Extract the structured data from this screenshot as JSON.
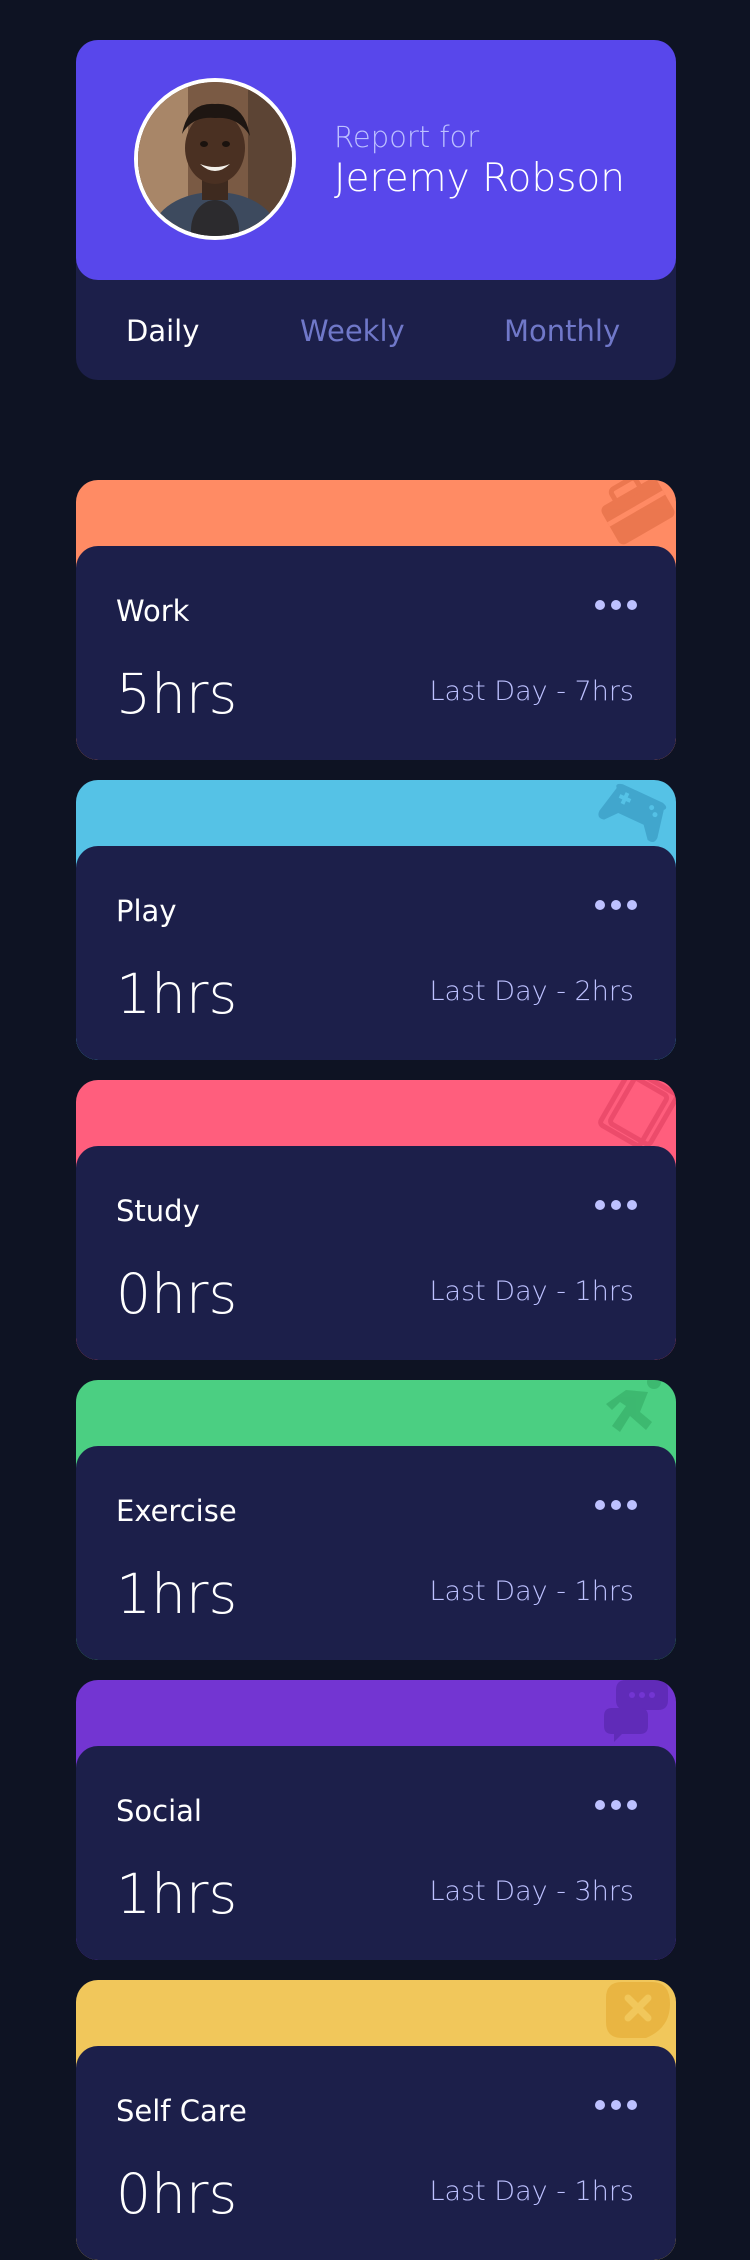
{
  "profile": {
    "report_for": "Report for",
    "name": "Jeremy Robson"
  },
  "tabs": [
    {
      "label": "Daily",
      "active": true
    },
    {
      "label": "Weekly",
      "active": false
    },
    {
      "label": "Monthly",
      "active": false
    }
  ],
  "activities": [
    {
      "title": "Work",
      "current": "5hrs",
      "previous": "Last Day - 7hrs",
      "color": "#ff8b64",
      "icon": "briefcase-icon"
    },
    {
      "title": "Play",
      "current": "1hrs",
      "previous": "Last Day - 2hrs",
      "color": "#55c2e6",
      "icon": "gamepad-icon"
    },
    {
      "title": "Study",
      "current": "0hrs",
      "previous": "Last Day - 1hrs",
      "color": "#ff5e7d",
      "icon": "book-icon"
    },
    {
      "title": "Exercise",
      "current": "1hrs",
      "previous": "Last Day - 1hrs",
      "color": "#4bcf82",
      "icon": "running-icon"
    },
    {
      "title": "Social",
      "current": "1hrs",
      "previous": "Last Day - 3hrs",
      "color": "#7335d2",
      "icon": "chat-icon"
    },
    {
      "title": "Self Care",
      "current": "0hrs",
      "previous": "Last Day - 1hrs",
      "color": "#f1c75b",
      "icon": "heart-care-icon"
    }
  ],
  "colors": {
    "background": "#0e1323",
    "card": "#1c1f4a",
    "accent": "#5847eb",
    "muted_text": "#bdc1ff",
    "inactive_tab": "#7078c9"
  }
}
